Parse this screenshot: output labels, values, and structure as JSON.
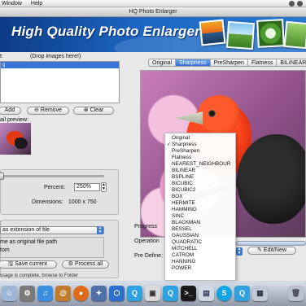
{
  "menubar": {
    "items": [
      "Window",
      "Help"
    ]
  },
  "window": {
    "title": "HQ Photo Enlarger"
  },
  "banner": {
    "title": "High Quality Photo Enlarger"
  },
  "input": {
    "label": "t:",
    "drop_hint": "(Drop images here!)",
    "selected_row": "g"
  },
  "buttons": {
    "add": "Add",
    "remove": "Remove",
    "clear": "Clear",
    "save_current": "Save current",
    "process_all": "Process all",
    "edit_new": "Edit/New"
  },
  "preview": {
    "label": "ail preview:"
  },
  "resize": {
    "percent_label": "Percent:",
    "percent_value": "250%",
    "dimensions_label": "Dimensions:",
    "dimensions_value": "1000 x 750"
  },
  "output": {
    "group_label": ":",
    "select_value": "as extension of file",
    "radio1": "me as original file path",
    "radio2": "tom",
    "status": "ssage is complete, browse to Folder"
  },
  "tabs": [
    "Original",
    "Sharpness",
    "PreSharpen",
    "Flatness",
    "BILINEAR"
  ],
  "active_tab": "Sharpness",
  "dropdown": {
    "items": [
      "Original",
      "Sharpness",
      "PreSharpen",
      "Flatness",
      "NEAREST_NEIGHBOUR",
      "BILINEAR",
      "BSPLINE",
      "BICUBIC",
      "BICUBIC2",
      "BOX",
      "HERMITE",
      "HAMMING",
      "SINC",
      "BLACKMAN",
      "BESSEL",
      "GAUSSIAN",
      "QUADRATIC",
      "MITCHELL",
      "CATROM",
      "HANNING",
      "POWER"
    ],
    "checked": "Sharpness"
  },
  "bottom": {
    "progress_label": "Progress",
    "operation_label": "Operation",
    "predefine_label": "Pre Define:"
  },
  "colors": {
    "banner": "#1d66c2",
    "accent": "#3875d7",
    "dock": "#8c96a8"
  },
  "dock": {
    "icons": [
      "finder-icon",
      "system-preferences-icon",
      "itunes-icon",
      "address-book-icon",
      "firefox-icon",
      "utilities-icon",
      "launchpad-icon",
      "quicktime-icon",
      "app-icon",
      "quicktime-icon-2",
      "terminal-icon",
      "preview-icon",
      "skype-icon",
      "quicktime-icon-3",
      "app-icon-2",
      "trash-icon"
    ]
  }
}
